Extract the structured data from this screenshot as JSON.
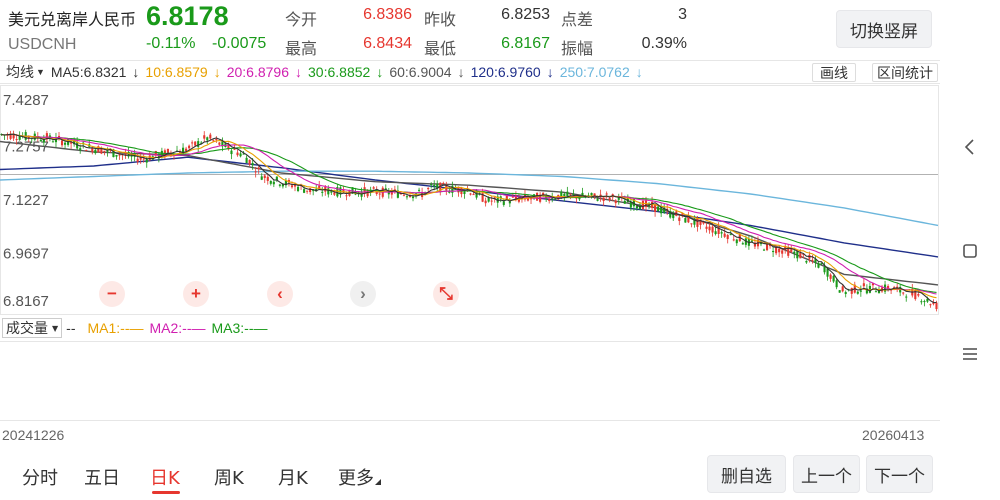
{
  "header": {
    "name": "美元兑离岸人民币",
    "code": "USDCNH",
    "price": "6.8178",
    "change_pct": "-0.11%",
    "change": "-0.0075",
    "switch_button": "切换竖屏"
  },
  "quotes": {
    "open_label": "今开",
    "open": "6.8386",
    "prev_close_label": "昨收",
    "prev_close": "6.8253",
    "spread_label": "点差",
    "spread": "3",
    "high_label": "最高",
    "high": "6.8434",
    "low_label": "最低",
    "low": "6.8167",
    "amplitude_label": "振幅",
    "amplitude": "0.39%"
  },
  "ma_legend": {
    "selector": "均线",
    "items": [
      {
        "label": "MA5:6.8321",
        "arrow": "↓",
        "color": "#333333"
      },
      {
        "label": "10:6.8579",
        "arrow": "↓",
        "color": "#e8a000"
      },
      {
        "label": "20:6.8796",
        "arrow": "↓",
        "color": "#d01fb0"
      },
      {
        "label": "30:6.8852",
        "arrow": "↓",
        "color": "#1a9a1a"
      },
      {
        "label": "60:6.9004",
        "arrow": "↓",
        "color": "#555555"
      },
      {
        "label": "120:6.9760",
        "arrow": "↓",
        "color": "#1f2f8a"
      },
      {
        "label": "250:7.0762",
        "arrow": "↓",
        "color": "#6bb6dc"
      }
    ],
    "draw_button": "画线",
    "range_stats_button": "区间统计"
  },
  "colors": {
    "up": "#e6372f",
    "down": "#1a9a1a",
    "ma5": "#333333",
    "ma10": "#e8a000",
    "ma20": "#d01fb0",
    "ma30": "#1a9a1a",
    "ma60": "#555555",
    "ma120": "#1f2f8a",
    "ma250": "#6bb6dc"
  },
  "chart_data": {
    "type": "candlestick",
    "start_date": "20241226",
    "end_date": "20260413",
    "y_ticks": [
      "7.4287",
      "7.2757",
      "7.1227",
      "6.9697",
      "6.8167"
    ],
    "ylim": [
      6.8167,
      7.4287
    ],
    "reference_price": 7.2757,
    "ma_series": [
      {
        "key": "ma120",
        "points": [
          [
            0,
            7.21
          ],
          [
            0.1,
            7.22
          ],
          [
            0.2,
            7.245
          ],
          [
            0.3,
            7.215
          ],
          [
            0.4,
            7.18
          ],
          [
            0.5,
            7.15
          ],
          [
            0.6,
            7.12
          ],
          [
            0.7,
            7.09
          ],
          [
            0.8,
            7.05
          ],
          [
            0.9,
            7.0
          ],
          [
            1.0,
            6.96
          ]
        ]
      },
      {
        "key": "ma250",
        "points": [
          [
            0,
            7.18
          ],
          [
            0.1,
            7.19
          ],
          [
            0.2,
            7.2
          ],
          [
            0.3,
            7.205
          ],
          [
            0.4,
            7.205
          ],
          [
            0.5,
            7.2
          ],
          [
            0.6,
            7.19
          ],
          [
            0.7,
            7.17
          ],
          [
            0.8,
            7.14
          ],
          [
            0.9,
            7.1
          ],
          [
            1.0,
            7.05
          ]
        ]
      },
      {
        "key": "ma60",
        "points": [
          [
            0,
            7.29
          ],
          [
            0.1,
            7.26
          ],
          [
            0.2,
            7.25
          ],
          [
            0.3,
            7.2
          ],
          [
            0.4,
            7.175
          ],
          [
            0.5,
            7.165
          ],
          [
            0.6,
            7.145
          ],
          [
            0.7,
            7.1
          ],
          [
            0.8,
            7.02
          ],
          [
            0.9,
            6.91
          ],
          [
            1.0,
            6.88
          ]
        ]
      }
    ],
    "price_path": [
      [
        0,
        7.31
      ],
      [
        0.05,
        7.3
      ],
      [
        0.1,
        7.27
      ],
      [
        0.15,
        7.24
      ],
      [
        0.2,
        7.27
      ],
      [
        0.22,
        7.3
      ],
      [
        0.26,
        7.25
      ],
      [
        0.28,
        7.19
      ],
      [
        0.33,
        7.15
      ],
      [
        0.4,
        7.145
      ],
      [
        0.45,
        7.14
      ],
      [
        0.46,
        7.16
      ],
      [
        0.5,
        7.15
      ],
      [
        0.52,
        7.12
      ],
      [
        0.58,
        7.13
      ],
      [
        0.6,
        7.135
      ],
      [
        0.65,
        7.13
      ],
      [
        0.7,
        7.1
      ],
      [
        0.75,
        7.05
      ],
      [
        0.8,
        7.0
      ],
      [
        0.85,
        6.97
      ],
      [
        0.88,
        6.93
      ],
      [
        0.9,
        6.86
      ],
      [
        0.92,
        6.87
      ],
      [
        0.95,
        6.87
      ],
      [
        0.98,
        6.85
      ],
      [
        1.0,
        6.82
      ]
    ]
  },
  "zoom_controls": [
    "−",
    "+",
    "‹",
    "›",
    "⤡"
  ],
  "volume": {
    "selector": "成交量",
    "sep": "--",
    "ma1": "MA1:--—",
    "ma2": "MA2:--—",
    "ma3": "MA3:--—",
    "ma1_color": "#e8a000",
    "ma2_color": "#d01fb0",
    "ma3_color": "#1a9a1a"
  },
  "tabs": {
    "intraday": "分时",
    "five_day": "五日",
    "daily": "日K",
    "weekly": "周K",
    "monthly": "月K",
    "more": "更多"
  },
  "actions": {
    "remove_watch": "删自选",
    "prev": "上一个",
    "next": "下一个"
  }
}
